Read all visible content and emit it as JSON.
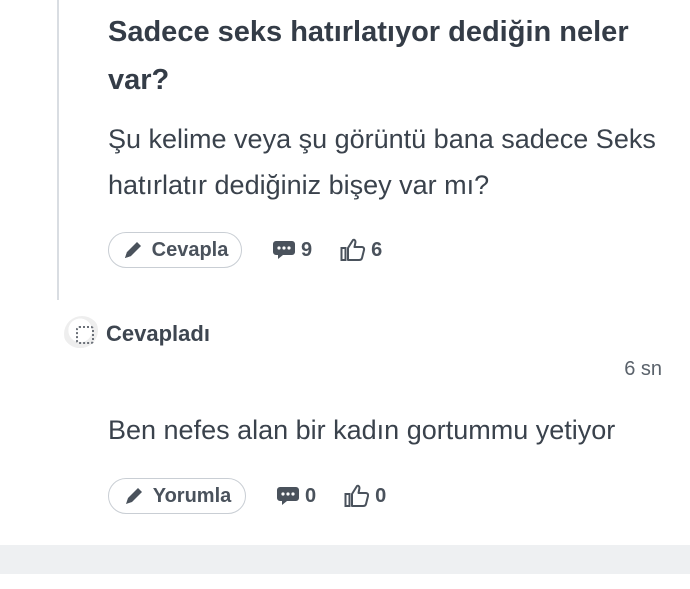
{
  "question": {
    "title": "Sadece seks hatırlatıyor dediğin neler var?",
    "body": "Şu kelime veya şu görüntü bana sadece Seks hatırlatır dediğiniz bişey var mı?",
    "reply_button_label": "Cevapla",
    "comment_count": "9",
    "like_count": "6"
  },
  "answer": {
    "author_label": "Cevapladı",
    "timestamp": "6 sn",
    "body": "Ben nefes alan bir kadın gortummu yetiyor",
    "comment_button_label": "Yorumla",
    "comment_count": "0",
    "like_count": "0"
  },
  "icons": {
    "pencil": "pencil-icon",
    "comment": "comment-bubble-icon",
    "like": "thumbs-up-icon"
  }
}
